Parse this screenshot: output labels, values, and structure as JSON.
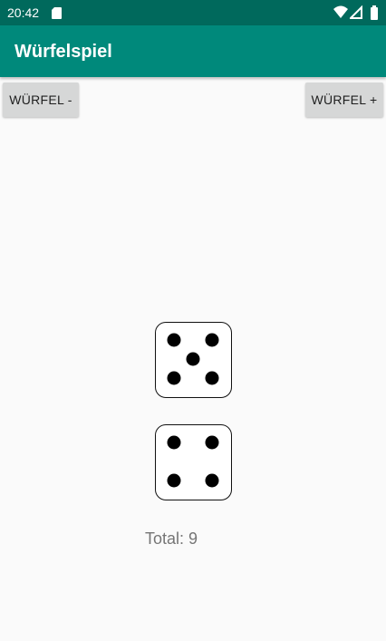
{
  "status_bar": {
    "time": "20:42",
    "icons": [
      "sd-card-icon",
      "wifi-icon",
      "signal-icon",
      "battery-icon"
    ],
    "color": "#00695c"
  },
  "app_bar": {
    "title": "Würfelspiel",
    "color": "#00897b"
  },
  "controls": {
    "remove_die_label": "WÜRFEL -",
    "add_die_label": "WÜRFEL +"
  },
  "dice": [
    {
      "value": 5
    },
    {
      "value": 4
    }
  ],
  "total": {
    "text": "Total: 9"
  }
}
